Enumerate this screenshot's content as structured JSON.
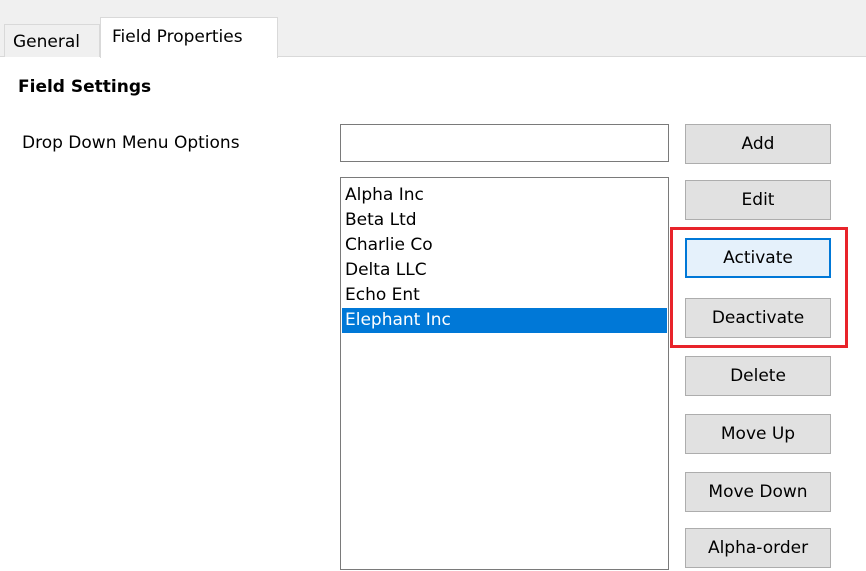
{
  "tabs": {
    "general": "General",
    "field_properties": "Field Properties"
  },
  "section": {
    "title": "Field Settings"
  },
  "field": {
    "label": "Drop Down Menu Options",
    "input_value": ""
  },
  "list": {
    "items": [
      "Alpha Inc",
      "Beta Ltd",
      "Charlie Co",
      "Delta LLC",
      "Echo Ent",
      "Elephant Inc"
    ],
    "selected": "Elephant Inc"
  },
  "buttons": {
    "add": "Add",
    "edit": "Edit",
    "activate": "Activate",
    "deactivate": "Deactivate",
    "delete": "Delete",
    "move_up": "Move Up",
    "move_down": "Move Down",
    "alpha_order": "Alpha-order"
  },
  "colors": {
    "selection": "#0078d7",
    "highlight_border": "#e8232a",
    "button_face": "#e1e1e1"
  }
}
